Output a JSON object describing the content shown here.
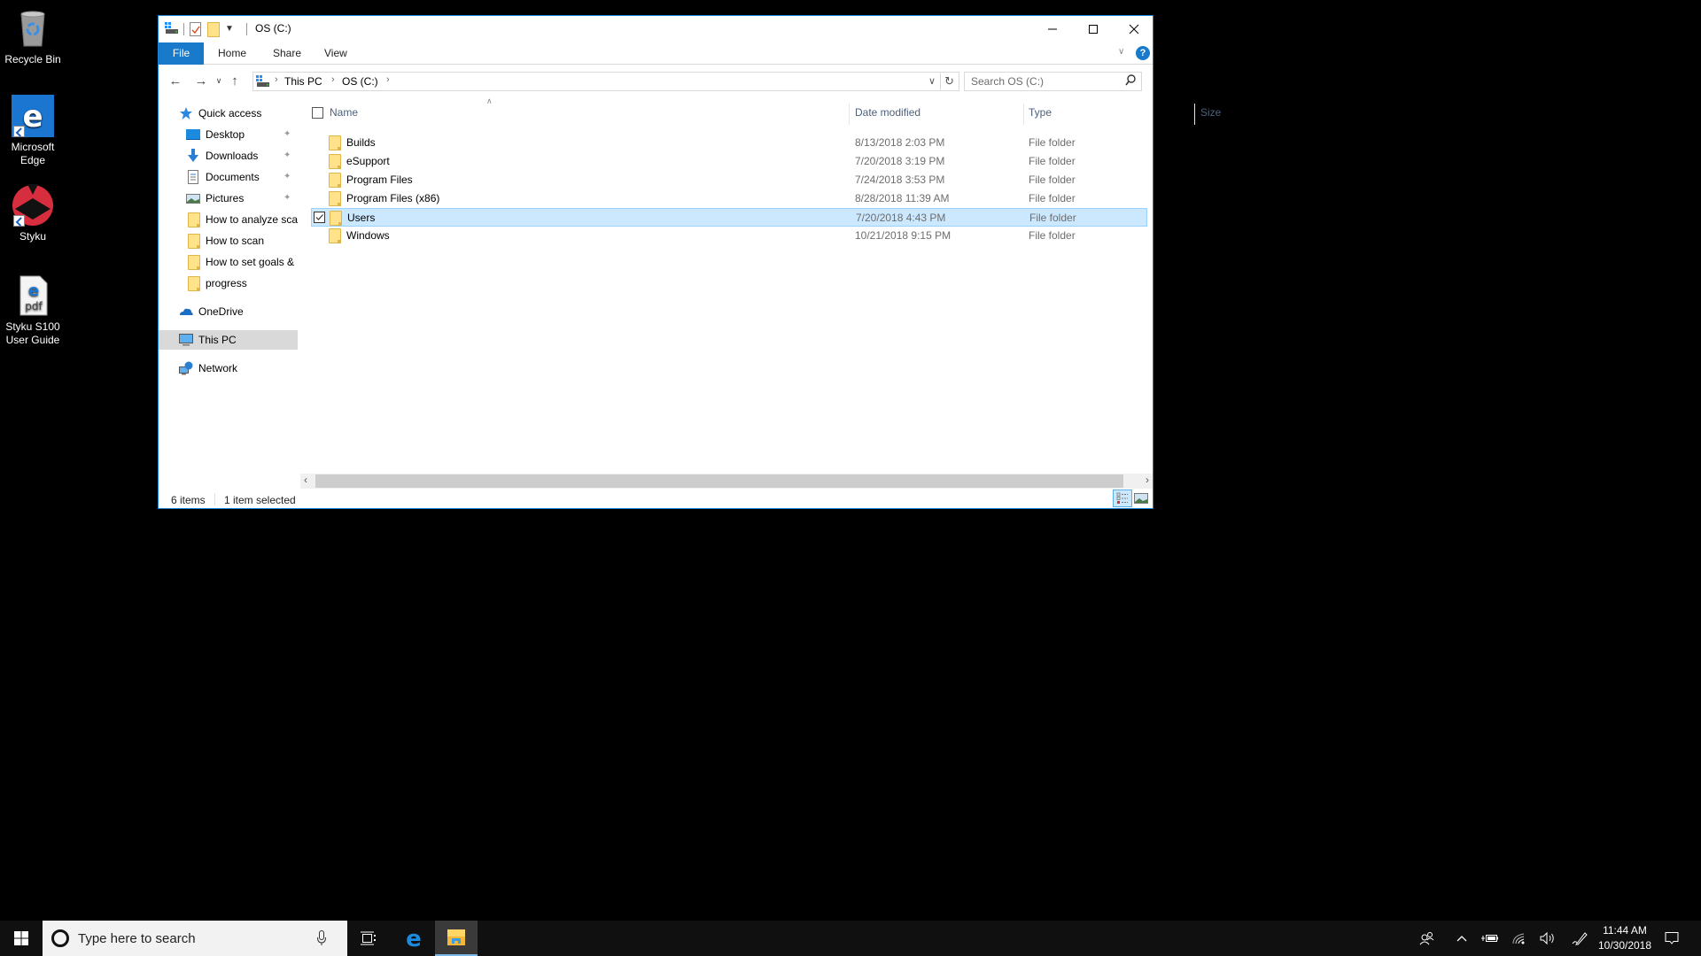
{
  "desktop": {
    "icons": [
      {
        "label": "Recycle Bin",
        "icon": "recycle-bin-icon"
      },
      {
        "label": "Microsoft Edge",
        "icon": "edge-icon"
      },
      {
        "label": "Styku",
        "icon": "styku-icon"
      },
      {
        "label": "Styku S100 User Guide",
        "icon": "pdf-icon"
      }
    ]
  },
  "window": {
    "title": "OS (C:)",
    "ribbon_tabs": [
      "File",
      "Home",
      "Share",
      "View"
    ],
    "address": {
      "crumbs": [
        "This PC",
        "OS (C:)"
      ]
    },
    "search": {
      "placeholder": "Search OS (C:)"
    },
    "nav": {
      "quick_access": "Quick access",
      "pinned": [
        {
          "label": "Desktop",
          "icon": "desktop-icon",
          "pinned": true
        },
        {
          "label": "Downloads",
          "icon": "downloads-icon",
          "pinned": true
        },
        {
          "label": "Documents",
          "icon": "documents-icon",
          "pinned": true
        },
        {
          "label": "Pictures",
          "icon": "pictures-icon",
          "pinned": true
        },
        {
          "label": "How to analyze scans",
          "icon": "folder-icon",
          "pinned": false
        },
        {
          "label": "How to scan",
          "icon": "folder-icon",
          "pinned": false
        },
        {
          "label": "How to set goals &",
          "icon": "folder-icon",
          "pinned": false
        },
        {
          "label": "progress",
          "icon": "folder-icon",
          "pinned": false
        }
      ],
      "onedrive": "OneDrive",
      "this_pc": "This PC",
      "network": "Network",
      "selected": "This PC"
    },
    "columns": [
      "Name",
      "Date modified",
      "Type",
      "Size"
    ],
    "files": [
      {
        "name": "Builds",
        "date": "8/13/2018 2:03 PM",
        "type": "File folder",
        "size": "",
        "selected": false
      },
      {
        "name": "eSupport",
        "date": "7/20/2018 3:19 PM",
        "type": "File folder",
        "size": "",
        "selected": false
      },
      {
        "name": "Program Files",
        "date": "7/24/2018 3:53 PM",
        "type": "File folder",
        "size": "",
        "selected": false
      },
      {
        "name": "Program Files (x86)",
        "date": "8/28/2018 11:39 AM",
        "type": "File folder",
        "size": "",
        "selected": false
      },
      {
        "name": "Users",
        "date": "7/20/2018 4:43 PM",
        "type": "File folder",
        "size": "",
        "selected": true
      },
      {
        "name": "Windows",
        "date": "10/21/2018 9:15 PM",
        "type": "File folder",
        "size": "",
        "selected": false
      }
    ],
    "status": {
      "items": "6 items",
      "selected": "1 item selected"
    }
  },
  "taskbar": {
    "search_placeholder": "Type here to search",
    "time": "11:44 AM",
    "date": "10/30/2018",
    "colors": {
      "accent": "#1979ca",
      "selection": "#cce8ff"
    }
  }
}
